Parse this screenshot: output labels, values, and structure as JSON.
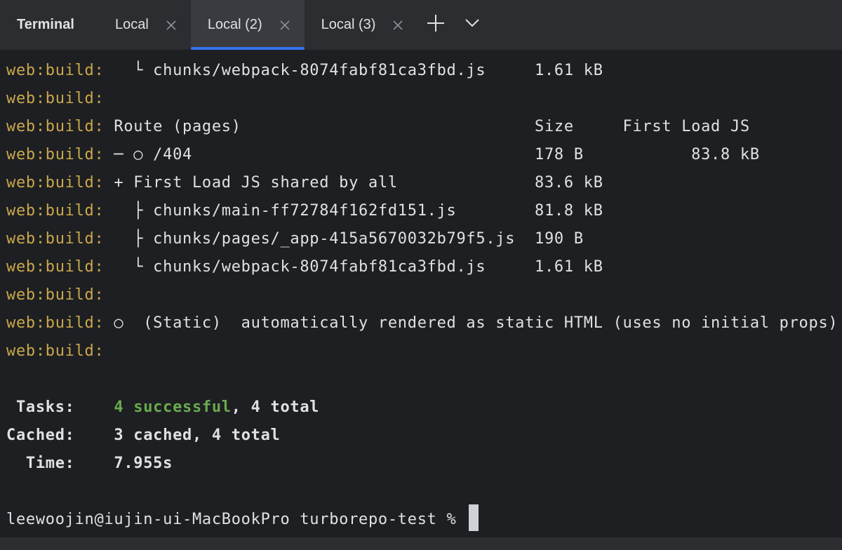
{
  "tabbar": {
    "title": "Terminal",
    "tabs": [
      {
        "label": "Local",
        "active": false
      },
      {
        "label": "Local (2)",
        "active": true
      },
      {
        "label": "Local (3)",
        "active": false
      }
    ],
    "new_tab_icon": "plus-icon",
    "more_icon": "chevron-down-icon"
  },
  "terminal": {
    "prefix": "web:build:",
    "lines": [
      "   └ chunks/webpack-8074fabf81ca3fbd.js     1.61 kB",
      "",
      " Route (pages)                              Size     First Load JS",
      " ─ ○ /404                                   178 B           83.8 kB",
      " + First Load JS shared by all              83.6 kB",
      "   ├ chunks/main-ff72784f162fd151.js        81.8 kB",
      "   ├ chunks/pages/_app-415a5670032b79f5.js  190 B",
      "   └ chunks/webpack-8074fabf81ca3fbd.js     1.61 kB",
      "",
      " ○  (Static)  automatically rendered as static HTML (uses no initial props)",
      ""
    ],
    "summary": {
      "tasks_label": " Tasks:    ",
      "tasks_success": "4 successful",
      "tasks_rest": ", 4 total",
      "cached_label": "Cached:    ",
      "cached_value": "3 cached, 4 total",
      "time_label": "  Time:    ",
      "time_value": "7.955s"
    },
    "prompt": "leewoojin@iujin-ui-MacBookPro turborepo-test % "
  },
  "colors": {
    "prefix": "#c9a84c",
    "success": "#6aab4f",
    "accent": "#3574f0",
    "background": "#1e1f22",
    "tabbar": "#2b2d30"
  }
}
